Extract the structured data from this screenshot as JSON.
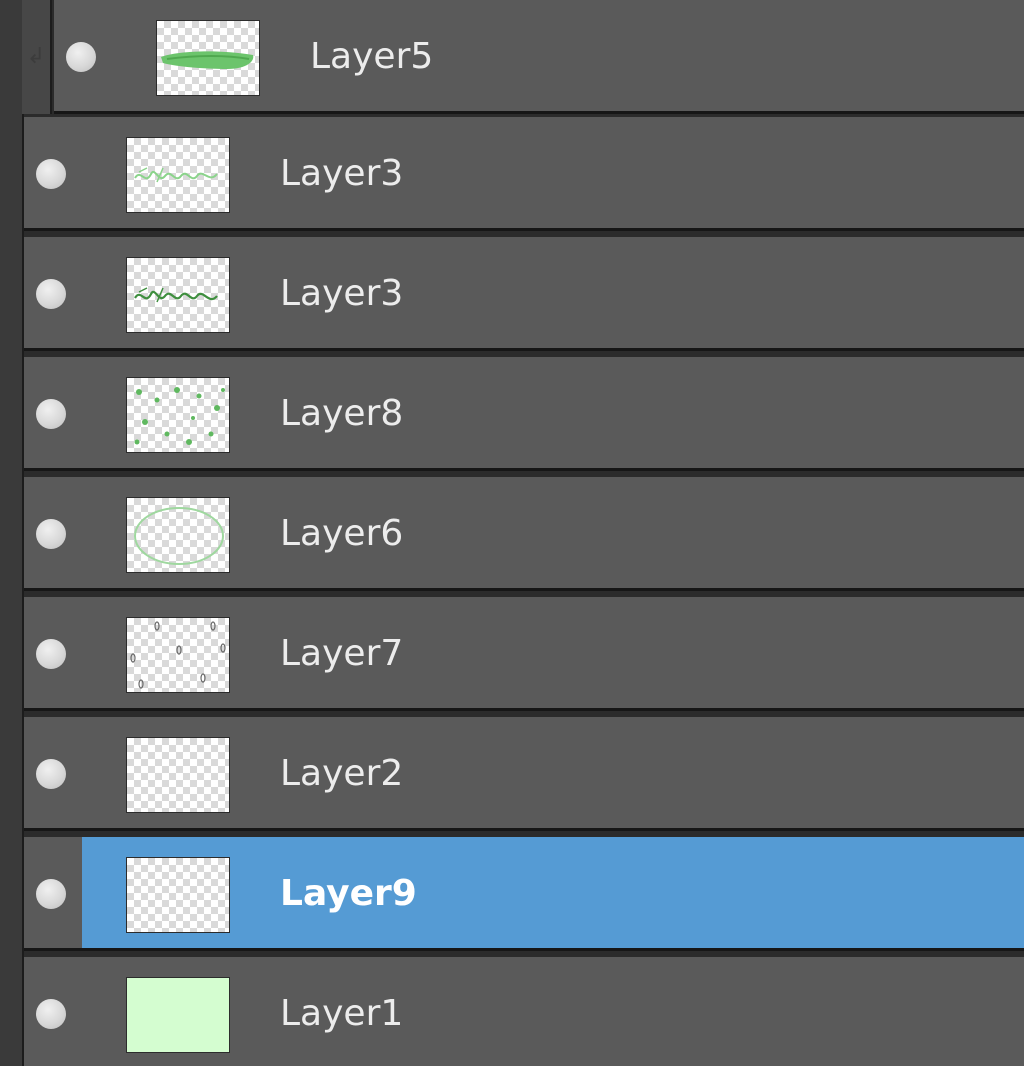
{
  "panel_title": "",
  "colors": {
    "row_bg": "#5a5a5a",
    "selected_bg": "#559bd4",
    "separator": "#161616",
    "text": "#ececec",
    "layer1_fill": "#d4fdd0",
    "stroke_green": "#6cc46c"
  },
  "layers": [
    {
      "name": "Layer5",
      "visible_icon": "eye-dot-icon",
      "clipped": true,
      "selected": false,
      "thumbnail": "green-brush-stroke"
    },
    {
      "name": "Layer3",
      "visible_icon": "eye-dot-icon",
      "clipped": false,
      "selected": false,
      "thumbnail": "green-lettering-light"
    },
    {
      "name": "Layer3",
      "visible_icon": "eye-dot-icon",
      "clipped": false,
      "selected": false,
      "thumbnail": "green-lettering-dark"
    },
    {
      "name": "Layer8",
      "visible_icon": "eye-dot-icon",
      "clipped": false,
      "selected": false,
      "thumbnail": "green-dots"
    },
    {
      "name": "Layer6",
      "visible_icon": "eye-dot-icon",
      "clipped": false,
      "selected": false,
      "thumbnail": "green-oval"
    },
    {
      "name": "Layer7",
      "visible_icon": "eye-dot-icon",
      "clipped": false,
      "selected": false,
      "thumbnail": "small-marks"
    },
    {
      "name": "Layer2",
      "visible_icon": "eye-dot-icon",
      "clipped": false,
      "selected": false,
      "thumbnail": "empty"
    },
    {
      "name": "Layer9",
      "visible_icon": "eye-dot-icon",
      "clipped": false,
      "selected": true,
      "thumbnail": "empty"
    },
    {
      "name": "Layer1",
      "visible_icon": "eye-dot-icon",
      "clipped": false,
      "selected": false,
      "thumbnail": "solid-light-green"
    }
  ]
}
